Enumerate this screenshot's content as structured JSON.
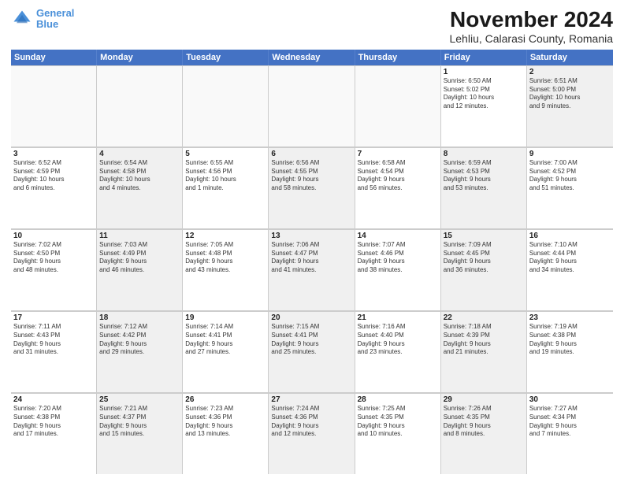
{
  "logo": {
    "line1": "General",
    "line2": "Blue"
  },
  "title": "November 2024",
  "subtitle": "Lehliu, Calarasi County, Romania",
  "header_days": [
    "Sunday",
    "Monday",
    "Tuesday",
    "Wednesday",
    "Thursday",
    "Friday",
    "Saturday"
  ],
  "weeks": [
    [
      {
        "day": "",
        "info": "",
        "shaded": false,
        "empty": true
      },
      {
        "day": "",
        "info": "",
        "shaded": false,
        "empty": true
      },
      {
        "day": "",
        "info": "",
        "shaded": false,
        "empty": true
      },
      {
        "day": "",
        "info": "",
        "shaded": false,
        "empty": true
      },
      {
        "day": "",
        "info": "",
        "shaded": false,
        "empty": true
      },
      {
        "day": "1",
        "info": "Sunrise: 6:50 AM\nSunset: 5:02 PM\nDaylight: 10 hours\nand 12 minutes.",
        "shaded": false,
        "empty": false
      },
      {
        "day": "2",
        "info": "Sunrise: 6:51 AM\nSunset: 5:00 PM\nDaylight: 10 hours\nand 9 minutes.",
        "shaded": true,
        "empty": false
      }
    ],
    [
      {
        "day": "3",
        "info": "Sunrise: 6:52 AM\nSunset: 4:59 PM\nDaylight: 10 hours\nand 6 minutes.",
        "shaded": false,
        "empty": false
      },
      {
        "day": "4",
        "info": "Sunrise: 6:54 AM\nSunset: 4:58 PM\nDaylight: 10 hours\nand 4 minutes.",
        "shaded": true,
        "empty": false
      },
      {
        "day": "5",
        "info": "Sunrise: 6:55 AM\nSunset: 4:56 PM\nDaylight: 10 hours\nand 1 minute.",
        "shaded": false,
        "empty": false
      },
      {
        "day": "6",
        "info": "Sunrise: 6:56 AM\nSunset: 4:55 PM\nDaylight: 9 hours\nand 58 minutes.",
        "shaded": true,
        "empty": false
      },
      {
        "day": "7",
        "info": "Sunrise: 6:58 AM\nSunset: 4:54 PM\nDaylight: 9 hours\nand 56 minutes.",
        "shaded": false,
        "empty": false
      },
      {
        "day": "8",
        "info": "Sunrise: 6:59 AM\nSunset: 4:53 PM\nDaylight: 9 hours\nand 53 minutes.",
        "shaded": true,
        "empty": false
      },
      {
        "day": "9",
        "info": "Sunrise: 7:00 AM\nSunset: 4:52 PM\nDaylight: 9 hours\nand 51 minutes.",
        "shaded": false,
        "empty": false
      }
    ],
    [
      {
        "day": "10",
        "info": "Sunrise: 7:02 AM\nSunset: 4:50 PM\nDaylight: 9 hours\nand 48 minutes.",
        "shaded": false,
        "empty": false
      },
      {
        "day": "11",
        "info": "Sunrise: 7:03 AM\nSunset: 4:49 PM\nDaylight: 9 hours\nand 46 minutes.",
        "shaded": true,
        "empty": false
      },
      {
        "day": "12",
        "info": "Sunrise: 7:05 AM\nSunset: 4:48 PM\nDaylight: 9 hours\nand 43 minutes.",
        "shaded": false,
        "empty": false
      },
      {
        "day": "13",
        "info": "Sunrise: 7:06 AM\nSunset: 4:47 PM\nDaylight: 9 hours\nand 41 minutes.",
        "shaded": true,
        "empty": false
      },
      {
        "day": "14",
        "info": "Sunrise: 7:07 AM\nSunset: 4:46 PM\nDaylight: 9 hours\nand 38 minutes.",
        "shaded": false,
        "empty": false
      },
      {
        "day": "15",
        "info": "Sunrise: 7:09 AM\nSunset: 4:45 PM\nDaylight: 9 hours\nand 36 minutes.",
        "shaded": true,
        "empty": false
      },
      {
        "day": "16",
        "info": "Sunrise: 7:10 AM\nSunset: 4:44 PM\nDaylight: 9 hours\nand 34 minutes.",
        "shaded": false,
        "empty": false
      }
    ],
    [
      {
        "day": "17",
        "info": "Sunrise: 7:11 AM\nSunset: 4:43 PM\nDaylight: 9 hours\nand 31 minutes.",
        "shaded": false,
        "empty": false
      },
      {
        "day": "18",
        "info": "Sunrise: 7:12 AM\nSunset: 4:42 PM\nDaylight: 9 hours\nand 29 minutes.",
        "shaded": true,
        "empty": false
      },
      {
        "day": "19",
        "info": "Sunrise: 7:14 AM\nSunset: 4:41 PM\nDaylight: 9 hours\nand 27 minutes.",
        "shaded": false,
        "empty": false
      },
      {
        "day": "20",
        "info": "Sunrise: 7:15 AM\nSunset: 4:41 PM\nDaylight: 9 hours\nand 25 minutes.",
        "shaded": true,
        "empty": false
      },
      {
        "day": "21",
        "info": "Sunrise: 7:16 AM\nSunset: 4:40 PM\nDaylight: 9 hours\nand 23 minutes.",
        "shaded": false,
        "empty": false
      },
      {
        "day": "22",
        "info": "Sunrise: 7:18 AM\nSunset: 4:39 PM\nDaylight: 9 hours\nand 21 minutes.",
        "shaded": true,
        "empty": false
      },
      {
        "day": "23",
        "info": "Sunrise: 7:19 AM\nSunset: 4:38 PM\nDaylight: 9 hours\nand 19 minutes.",
        "shaded": false,
        "empty": false
      }
    ],
    [
      {
        "day": "24",
        "info": "Sunrise: 7:20 AM\nSunset: 4:38 PM\nDaylight: 9 hours\nand 17 minutes.",
        "shaded": false,
        "empty": false
      },
      {
        "day": "25",
        "info": "Sunrise: 7:21 AM\nSunset: 4:37 PM\nDaylight: 9 hours\nand 15 minutes.",
        "shaded": true,
        "empty": false
      },
      {
        "day": "26",
        "info": "Sunrise: 7:23 AM\nSunset: 4:36 PM\nDaylight: 9 hours\nand 13 minutes.",
        "shaded": false,
        "empty": false
      },
      {
        "day": "27",
        "info": "Sunrise: 7:24 AM\nSunset: 4:36 PM\nDaylight: 9 hours\nand 12 minutes.",
        "shaded": true,
        "empty": false
      },
      {
        "day": "28",
        "info": "Sunrise: 7:25 AM\nSunset: 4:35 PM\nDaylight: 9 hours\nand 10 minutes.",
        "shaded": false,
        "empty": false
      },
      {
        "day": "29",
        "info": "Sunrise: 7:26 AM\nSunset: 4:35 PM\nDaylight: 9 hours\nand 8 minutes.",
        "shaded": true,
        "empty": false
      },
      {
        "day": "30",
        "info": "Sunrise: 7:27 AM\nSunset: 4:34 PM\nDaylight: 9 hours\nand 7 minutes.",
        "shaded": false,
        "empty": false
      }
    ]
  ]
}
